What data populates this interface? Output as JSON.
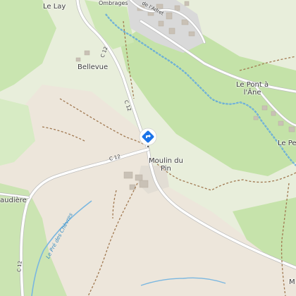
{
  "places": {
    "le_lay": "Le Lay",
    "ombrages": "Ombrages",
    "adret": "de l'Adret",
    "bellevue": "Bellevue",
    "le_pont": "Le Pont à\nl'Âne",
    "le_pet": "Le Pet",
    "moulin": "Moulin du\nPin",
    "audiere": "audière",
    "bottom_right": "M"
  },
  "roads": {
    "c12_a": "C 12",
    "c12_b": "C 12",
    "c12_c": "C 12",
    "c12_d": "C 12"
  },
  "water": {
    "stream": "Le Pré des Chèvres"
  },
  "marker": {
    "icon": "directions-diamond-icon",
    "color": "#1a73e8"
  },
  "colors": {
    "field": "#e8eedb",
    "forest": "#c4e2a8",
    "beige": "#ede6db",
    "river": "#3a8fc4",
    "path": "#a07850"
  }
}
